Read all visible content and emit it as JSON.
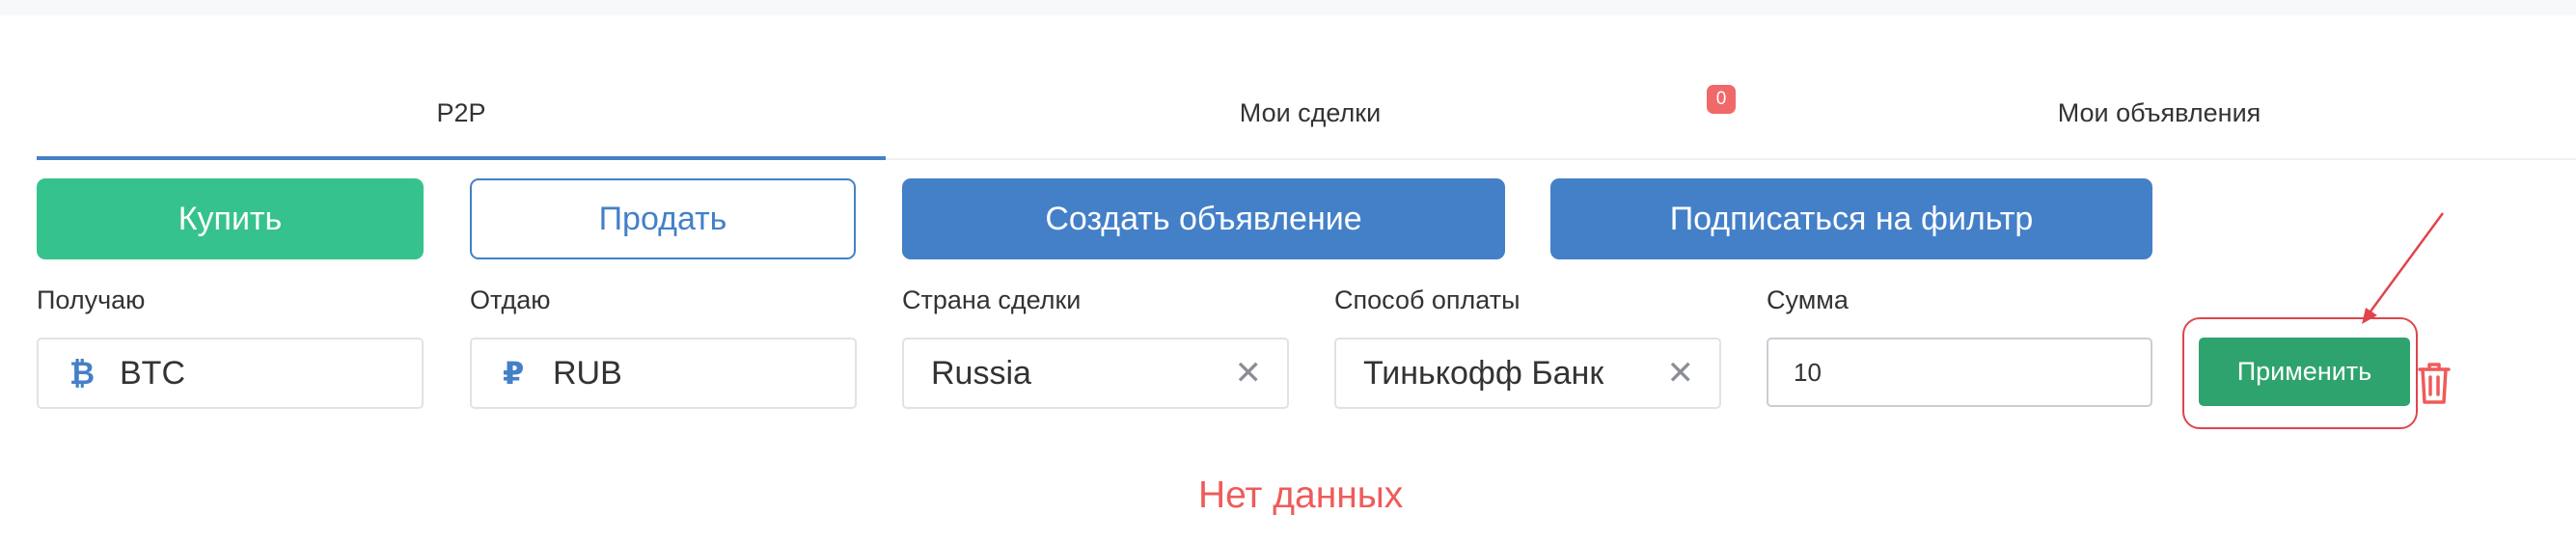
{
  "tabs": [
    {
      "label": "P2P",
      "active": true
    },
    {
      "label": "Мои сделки",
      "badge": "0"
    },
    {
      "label": "Мои объявления"
    }
  ],
  "actions": {
    "buy": "Купить",
    "sell": "Продать",
    "create_ad": "Создать объявление",
    "subscribe_filter": "Подписаться на фильтр"
  },
  "filters": {
    "receive": {
      "label": "Получаю",
      "icon": "bitcoin-icon",
      "icon_glyph": "₿",
      "value": "BTC"
    },
    "give": {
      "label": "Отдаю",
      "icon": "ruble-icon",
      "icon_glyph": "₽",
      "value": "RUB"
    },
    "country": {
      "label": "Страна сделки",
      "value": "Russia"
    },
    "payment": {
      "label": "Способ оплаты",
      "value": "Тинькофф Банк"
    },
    "amount": {
      "label": "Сумма",
      "value": "10"
    },
    "apply": "Применить"
  },
  "empty_state": "Нет данных",
  "colors": {
    "accent_green": "#36c28c",
    "accent_blue": "#4480c8",
    "apply_green": "#2fa36e",
    "badge_red": "#f06868",
    "annotation_red": "#e0454a",
    "empty_text": "#ef5b5b"
  }
}
